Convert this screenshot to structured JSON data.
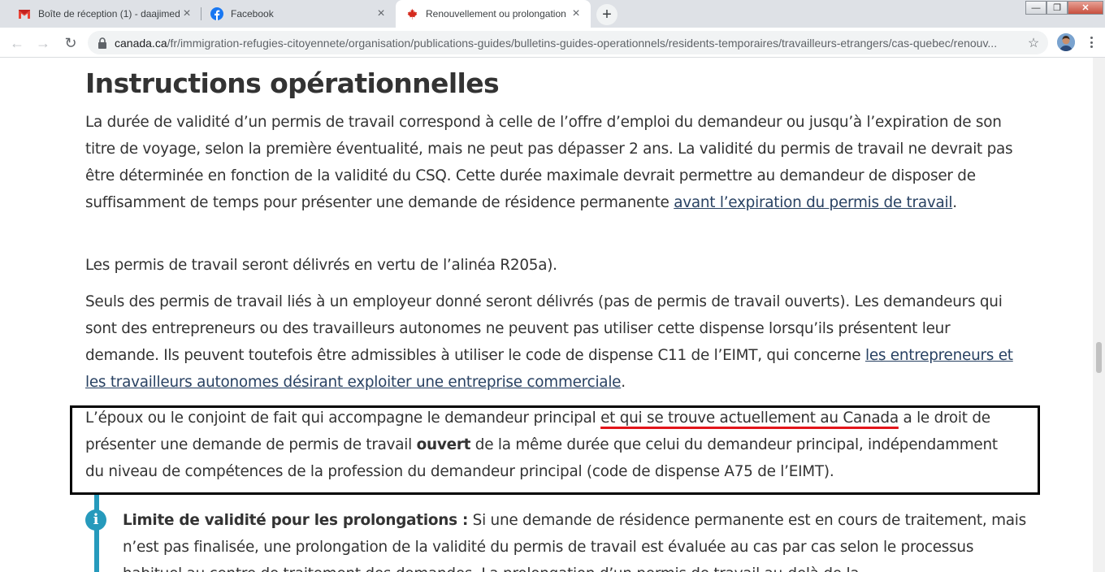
{
  "browser": {
    "tabs": [
      {
        "title": "Boîte de réception (1) - daajimed",
        "icon": "gmail-icon"
      },
      {
        "title": "Facebook",
        "icon": "facebook-icon"
      },
      {
        "title": "Renouvellement ou prolongation",
        "icon": "canada-maple-leaf-icon",
        "active": true
      }
    ],
    "close_glyph": "×",
    "new_tab_glyph": "+",
    "window_controls": {
      "minimize": "—",
      "maximize": "❐",
      "close": "✕"
    },
    "address": {
      "domain": "canada.ca",
      "path": "/fr/immigration-refugies-citoyennete/organisation/publications-guides/bulletins-guides-operationnels/residents-temporaires/travailleurs-etrangers/cas-quebec/renouv..."
    },
    "nav": {
      "back": "←",
      "forward": "→",
      "reload": "↻",
      "star": "☆"
    }
  },
  "article": {
    "heading": "Instructions opérationnelles",
    "p1_text": "La durée de validité d’un permis de travail correspond à celle de l’offre d’emploi du demandeur ou jusqu’à l’expiration de son titre de voyage, selon la première éventualité, mais ne peut pas dépasser 2 ans. La validité du permis de travail ne devrait pas être déterminée en fonction de la validité du CSQ. Cette durée maximale devrait permettre au demandeur de disposer de suffisamment de temps pour présenter une demande de résidence permanente ",
    "p1_link": "avant l’expiration du permis de travail",
    "p1_end": ".",
    "p2": "Les permis de travail seront délivrés en vertu de l’alinéa R205a).",
    "p3_text": "Seuls des permis de travail liés à un employeur donné seront délivrés (pas de permis de travail ouverts). Les demandeurs qui sont des entrepreneurs ou des travailleurs autonomes ne peuvent pas utiliser cette dispense lorsqu’ils présentent leur demande. Ils peuvent toutefois être admissibles à utiliser le code de dispense C11 de l’EIMT, qui concerne ",
    "p3_link": "les entrepreneurs et les travailleurs autonomes désirant exploiter une entreprise commerciale",
    "p3_end": ".",
    "p4_a": "L’époux ou le conjoint de fait qui accompagne le demandeur principal ",
    "p4_highlight": "et qui se trouve actuellement au Canada",
    "p4_b": " a le droit de présenter une demande de permis de travail ",
    "p4_bold": "ouvert",
    "p4_c": " de la même durée que celui du demandeur principal, indépendamment du niveau de compétences de la profession du demandeur principal (code de dispense A75 de l’EIMT).",
    "alert_icon_glyph": "i",
    "alert_title": "Limite de validité pour les prolongations :",
    "alert_text": " Si une demande de résidence permanente est en cours de traitement, mais n’est pas finalisée, une prolongation de la validité du permis de travail est évaluée au cas par cas selon le processus habituel au centre de traitement des demandes. La prolongation d’un permis de travail au-delà de la"
  },
  "colors": {
    "link": "#284162",
    "annotation_red": "#e3151a",
    "alert_accent": "#269abc",
    "tabbar": "#dee1e6"
  }
}
